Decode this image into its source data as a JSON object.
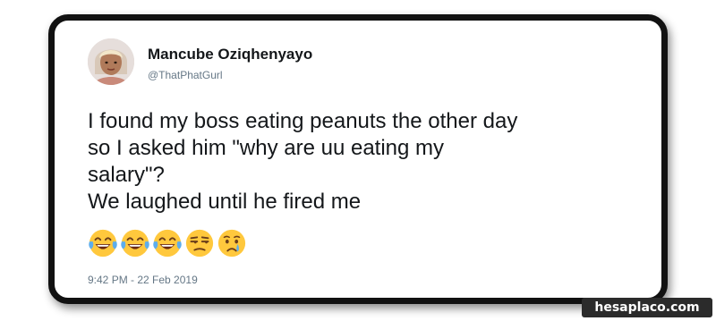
{
  "tweet": {
    "author_name": "Mancube Oziqhenyayo",
    "author_handle": "@ThatPhatGurl",
    "text_lines": [
      "I found my boss eating peanuts the other day",
      "so I asked him \"why are uu  eating my",
      "salary\"?",
      "We laughed until he fired me"
    ],
    "emojis": [
      "face-with-tears-of-joy-icon",
      "face-with-tears-of-joy-icon",
      "face-with-tears-of-joy-icon",
      "unamused-face-icon",
      "crying-face-icon"
    ],
    "timestamp": "9:42 PM - 22 Feb 2019"
  },
  "watermark": "hesaplaco.com",
  "colors": {
    "card_border": "#111111",
    "name_text": "#14171a",
    "meta_text": "#657786",
    "emoji_yellow": "#ffc83d",
    "tear_blue": "#5dadec"
  }
}
